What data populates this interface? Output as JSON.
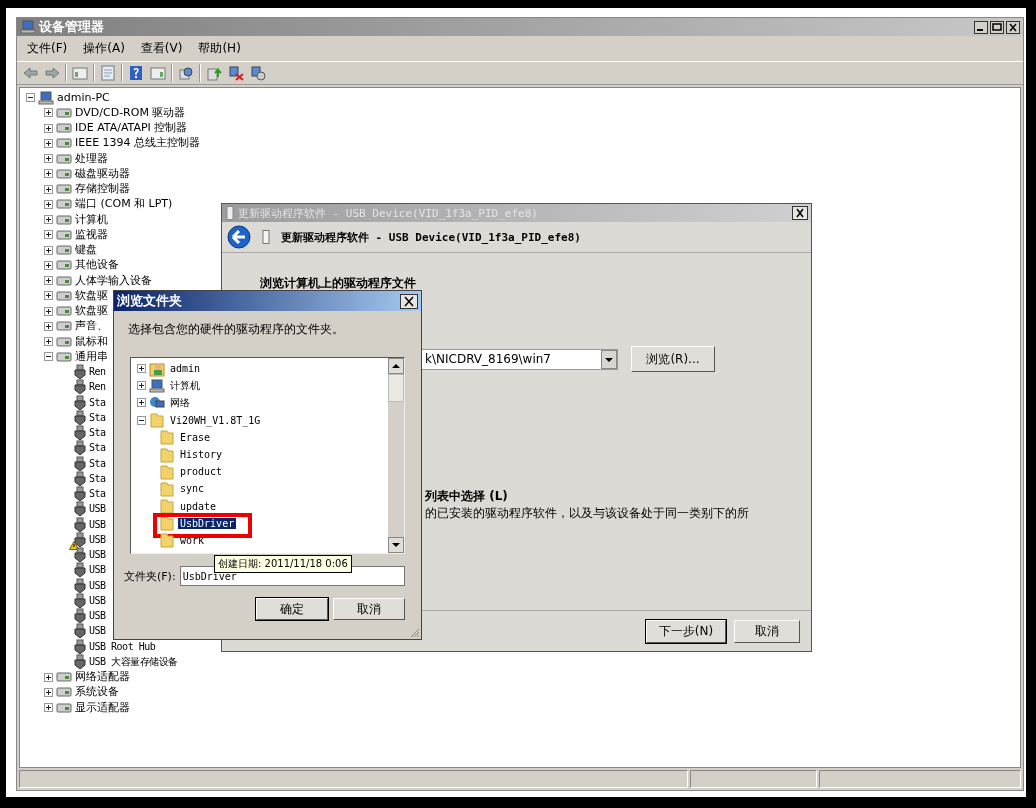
{
  "window": {
    "title": "设备管理器"
  },
  "menu": [
    "文件(F)",
    "操作(A)",
    "查看(V)",
    "帮助(H)"
  ],
  "device_tree": {
    "label": "admin-PC",
    "expanded": true,
    "children": [
      {
        "label": "DVD/CD-ROM 驱动器",
        "expanded": false
      },
      {
        "label": "IDE ATA/ATAPI 控制器",
        "expanded": false
      },
      {
        "label": "IEEE 1394 总线主控制器",
        "expanded": false
      },
      {
        "label": "处理器",
        "expanded": false
      },
      {
        "label": "磁盘驱动器",
        "expanded": false
      },
      {
        "label": "存储控制器",
        "expanded": false
      },
      {
        "label": "端口 (COM 和 LPT)",
        "expanded": false
      },
      {
        "label": "计算机",
        "expanded": false
      },
      {
        "label": "监视器",
        "expanded": false
      },
      {
        "label": "键盘",
        "expanded": false
      },
      {
        "label": "其他设备",
        "expanded": false
      },
      {
        "label": "人体学输入设备",
        "expanded": false
      },
      {
        "label": "软盘驱",
        "expanded": false
      },
      {
        "label": "软盘驱",
        "expanded": false
      },
      {
        "label": "声音、",
        "expanded": false
      },
      {
        "label": "鼠标和",
        "expanded": false
      },
      {
        "label": "通用串",
        "expanded": true,
        "children": [
          {
            "label": "Ren",
            "warning": false
          },
          {
            "label": "Ren",
            "warning": false
          },
          {
            "label": "Sta",
            "warning": false
          },
          {
            "label": "Sta",
            "warning": false
          },
          {
            "label": "Sta",
            "warning": false
          },
          {
            "label": "Sta",
            "warning": false
          },
          {
            "label": "Sta",
            "warning": false
          },
          {
            "label": "Sta",
            "warning": false
          },
          {
            "label": "Sta",
            "warning": false
          },
          {
            "label": "USB",
            "warning": false
          },
          {
            "label": "USB",
            "warning": false
          },
          {
            "label": "USB",
            "warning": true
          },
          {
            "label": "USB",
            "warning": false
          },
          {
            "label": "USB",
            "warning": false
          },
          {
            "label": "USB",
            "warning": false
          },
          {
            "label": "USB",
            "warning": false
          },
          {
            "label": "USB",
            "warning": false
          },
          {
            "label": "USB",
            "warning": false
          },
          {
            "label": "USB Root Hub",
            "warning": false
          },
          {
            "label": "USB 大容量存储设备",
            "warning": false
          }
        ]
      },
      {
        "label": "网络适配器",
        "expanded": false
      },
      {
        "label": "系统设备",
        "expanded": false
      },
      {
        "label": "显示适配器",
        "expanded": false
      }
    ]
  },
  "wizard": {
    "title": "更新驱动程序软件 - USB Device(VID_1f3a_PID_efe8)",
    "header": "更新驱动程序软件 - USB Device(VID_1f3a_PID_efe8)",
    "heading": "浏览计算机上的驱动程序文件",
    "path": "k\\NICDRV_8169\\win7",
    "browse_button": "浏览(R)...",
    "option_title": "列表中选择 (L)",
    "option_text": "的已安装的驱动程序软件，以及与该设备处于同一类别下的所",
    "buttons": [
      {
        "label": "下一步(N)",
        "default": true
      },
      {
        "label": "取消",
        "default": false
      }
    ]
  },
  "browse_dialog": {
    "title": "浏览文件夹",
    "prompt": "选择包含您的硬件的驱动程序的文件夹。",
    "folders": [
      {
        "label": "admin",
        "kind": "user",
        "expanded": false,
        "selected": false
      },
      {
        "label": "计算机",
        "kind": "computer",
        "expanded": false,
        "selected": false
      },
      {
        "label": "网络",
        "kind": "network",
        "expanded": false,
        "selected": false
      },
      {
        "label": "Vi20WH_V1.8T_1G",
        "kind": "folder",
        "expanded": true,
        "selected": false,
        "children": [
          {
            "label": "Erase",
            "kind": "folder",
            "selected": false
          },
          {
            "label": "History",
            "kind": "folder",
            "selected": false
          },
          {
            "label": "product",
            "kind": "folder",
            "selected": false
          },
          {
            "label": "sync",
            "kind": "folder",
            "selected": false
          },
          {
            "label": "update",
            "kind": "folder",
            "selected": false
          },
          {
            "label": "UsbDriver",
            "kind": "folder",
            "selected": true
          },
          {
            "label": "work",
            "kind": "folder",
            "selected": false
          }
        ]
      }
    ],
    "tooltip": "创建日期: 2011/11/18 0:06",
    "folder_label": "文件夹(F):",
    "folder_value": "UsbDriver",
    "buttons": [
      {
        "label": "确定",
        "default": true
      },
      {
        "label": "取消",
        "default": false
      }
    ]
  }
}
